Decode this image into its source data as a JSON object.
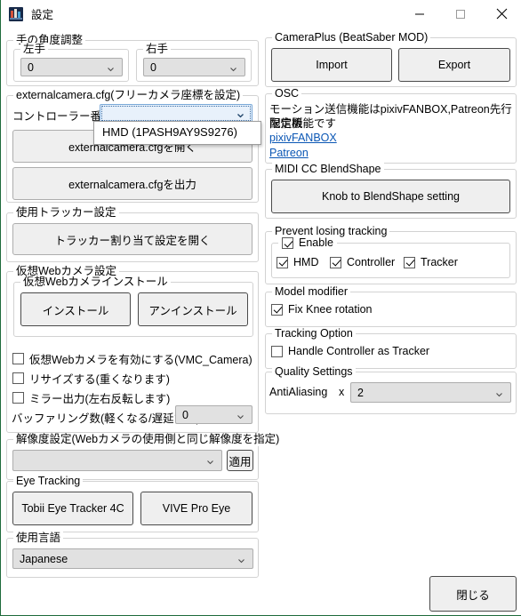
{
  "window": {
    "title": "設定",
    "icon": "app-icon",
    "controls": {
      "minimize": "minimize-icon",
      "maximize": "maximize-icon",
      "close": "close-icon"
    }
  },
  "left": {
    "hand_angle": {
      "title": "手の角度調整",
      "left_hand": {
        "title": "左手",
        "value": "0"
      },
      "right_hand": {
        "title": "右手",
        "value": "0"
      }
    },
    "externalcamera": {
      "title": "externalcamera.cfg(フリーカメラ座標を設定)",
      "controller_label": "コントローラー番号：",
      "controller_value": "",
      "dropdown_open": true,
      "dropdown_options": [
        "HMD (1PASH9AY9S9276)"
      ],
      "open_button": "externalcamera.cfgを開く",
      "export_button": "externalcamera.cfgを出力"
    },
    "tracker": {
      "title": "使用トラッカー設定",
      "assign_button": "トラッカー割り当て設定を開く"
    },
    "virtual_webcam": {
      "title": "仮想Webカメラ設定",
      "install_group_title": "仮想Webカメラインストール",
      "install_button": "インストール",
      "uninstall_button": "アンインストール",
      "enable_checkbox": "仮想Webカメラを有効にする(VMC_Camera)",
      "enable_checked": false,
      "resize_checkbox": "リサイズする(重くなります)",
      "resize_checked": false,
      "mirror_checkbox": "ミラー出力(左右反転します)",
      "mirror_checked": false,
      "buffering_label": "バッファリング数(軽くなる/遅延する)：",
      "buffering_value": "0"
    },
    "resolution": {
      "title": "解像度設定(Webカメラの使用側と同じ解像度を指定)",
      "value": "",
      "apply_button": "適用"
    },
    "eye_tracking": {
      "title": "Eye Tracking",
      "tobii_button": "Tobii Eye Tracker 4C",
      "vive_button": "VIVE Pro Eye"
    },
    "language": {
      "title": "使用言語",
      "value": "Japanese"
    }
  },
  "right": {
    "cameraplus": {
      "title": "CameraPlus (BeatSaber MOD)",
      "import_button": "Import",
      "export_button": "Export"
    },
    "osc": {
      "title": "OSC",
      "note_line1": "モーション送信機能はpixivFANBOX,Patreon先行配信版",
      "note_line2": "限定機能です",
      "link_fanbox": "pixivFANBOX",
      "link_patreon": "Patreon"
    },
    "midi": {
      "title": "MIDI CC BlendShape",
      "knob_button": "Knob to BlendShape setting"
    },
    "prevent_tracking": {
      "title": "Prevent losing tracking",
      "enable_label": "Enable",
      "enable_checked": true,
      "hmd_label": "HMD",
      "hmd_checked": true,
      "controller_label": "Controller",
      "controller_checked": true,
      "tracker_label": "Tracker",
      "tracker_checked": true
    },
    "model_modifier": {
      "title": "Model modifier",
      "fix_knee_label": "Fix Knee rotation",
      "fix_knee_checked": true
    },
    "tracking_option": {
      "title": "Tracking Option",
      "handle_controller_label": "Handle Controller as Tracker",
      "handle_controller_checked": false
    },
    "quality": {
      "title": "Quality Settings",
      "antialiasing_label": "AntiAliasing",
      "multiplier_label": "x",
      "value": "2"
    }
  },
  "footer": {
    "close_button": "閉じる"
  },
  "colors": {
    "link": "#0b57b5",
    "button_face": "#efefef",
    "combo_face": "#e1e1e1",
    "group_border": "#d2d2d2",
    "window_edge": "#1f6b3b"
  }
}
